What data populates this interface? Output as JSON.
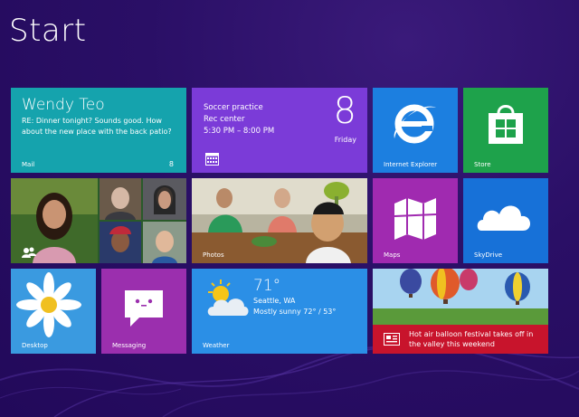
{
  "page": {
    "title": "Start"
  },
  "tiles": {
    "mail": {
      "from": "Wendy Teo",
      "message": "RE: Dinner tonight? Sounds good. How about the new place with the back patio?",
      "label": "Mail",
      "count": "8"
    },
    "calendar": {
      "event": "Soccer practice",
      "place": "Rec center",
      "time": "5:30 PM – 8:00 PM",
      "day": "8",
      "weekday": "Friday"
    },
    "ie": {
      "label": "Internet Explorer"
    },
    "store": {
      "label": "Store"
    },
    "people": {
      "label": ""
    },
    "photos": {
      "label": "Photos"
    },
    "maps": {
      "label": "Maps"
    },
    "skydrive": {
      "label": "SkyDrive"
    },
    "desktop": {
      "label": "Desktop"
    },
    "messaging": {
      "label": "Messaging"
    },
    "weather": {
      "temp": "71°",
      "location": "Seattle, WA",
      "condition": "Mostly sunny 72° / 53°",
      "label": "Weather"
    },
    "news": {
      "headline": "Hot air balloon festival takes off in the valley this weekend"
    }
  },
  "colors": {
    "background": "#2a0f66",
    "mail": "#15a3ad",
    "calendar": "#7b3bd8",
    "ie": "#1c7fe0",
    "store": "#1ea24b",
    "maps": "#a02ab0",
    "skydrive": "#1771d8",
    "desktop": "#2a89d6",
    "messaging": "#9b2fae",
    "weather": "#2b8fe6",
    "news_bar": "#c8142c"
  },
  "icons": [
    "calendar-icon",
    "ie-logo-icon",
    "store-bag-icon",
    "people-icon",
    "maps-icon",
    "cloud-icon",
    "smiley-chat-icon",
    "sun-cloud-icon",
    "news-icon"
  ]
}
